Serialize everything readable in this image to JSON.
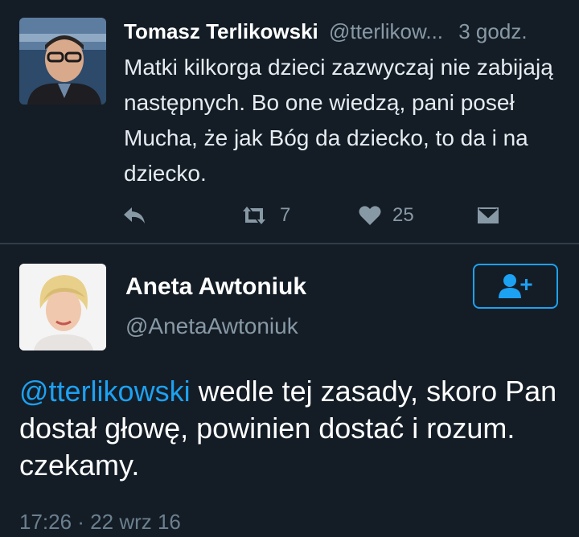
{
  "tweet1": {
    "author_name": "Tomasz Terlikowski",
    "handle": "@tterlikow...",
    "time": "3 godz.",
    "text": "Matki kilkorga dzieci zazwyczaj nie zabijają następnych. Bo one wiedzą, pani poseł Mucha, że jak Bóg da dziecko, to da i na dziecko.",
    "retweet_count": "7",
    "like_count": "25",
    "icons": [
      "reply-icon",
      "retweet-icon",
      "heart-icon",
      "direct-message-icon"
    ]
  },
  "tweet2": {
    "author_name": "Aneta Awtoniuk",
    "handle": "@AnetaAwtoniuk",
    "mention": "@tterlikowski",
    "text": " wedle tej zasady, skoro Pan dostał głowę, powinien dostać i rozum. czekamy.",
    "timestamp": "17:26 · 22 wrz 16",
    "follow_icon": "add-user-icon"
  },
  "colors": {
    "background": "#141d26",
    "link": "#1da1f2",
    "muted": "#8899a6",
    "divider": "#2f3d4c"
  }
}
